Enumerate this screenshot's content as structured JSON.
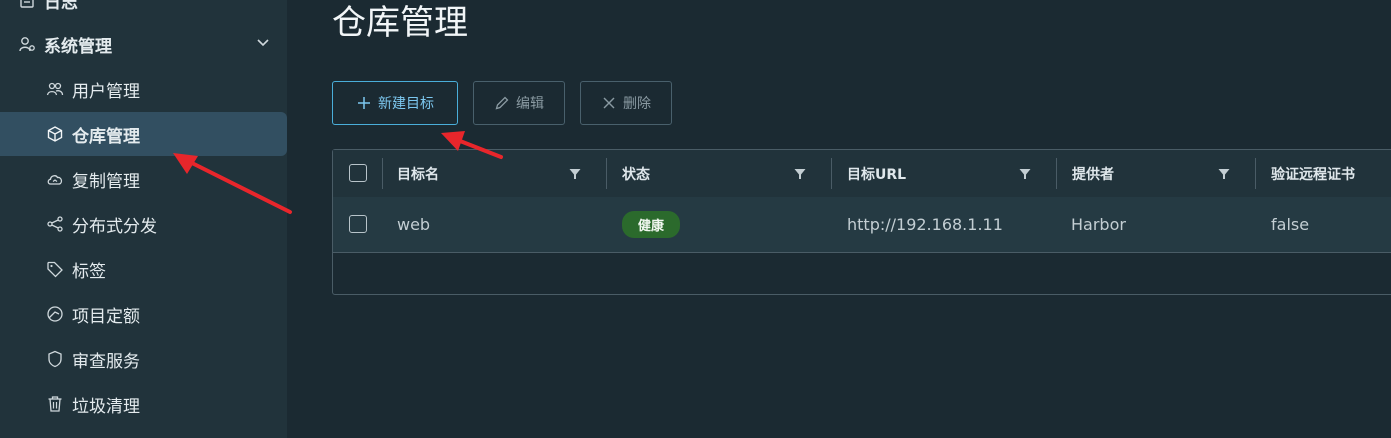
{
  "sidebar": {
    "items": [
      {
        "label": "日志",
        "icon": "log-icon"
      },
      {
        "label": "系统管理",
        "icon": "system-settings-icon"
      },
      {
        "label": "用户管理",
        "icon": "users-icon"
      },
      {
        "label": "仓库管理",
        "icon": "cube-icon"
      },
      {
        "label": "复制管理",
        "icon": "cloud-sync-icon"
      },
      {
        "label": "分布式分发",
        "icon": "share-icon"
      },
      {
        "label": "标签",
        "icon": "tag-icon"
      },
      {
        "label": "项目定额",
        "icon": "quota-icon"
      },
      {
        "label": "审查服务",
        "icon": "shield-icon"
      },
      {
        "label": "垃圾清理",
        "icon": "trash-icon"
      }
    ]
  },
  "main": {
    "title": "仓库管理",
    "toolbar": {
      "new_label": "新建目标",
      "edit_label": "编辑",
      "delete_label": "删除"
    },
    "table": {
      "columns": [
        "目标名",
        "状态",
        "目标URL",
        "提供者",
        "验证远程证书"
      ],
      "rows": [
        {
          "name": "web",
          "status": "健康",
          "url": "http://192.168.1.11",
          "provider": "Harbor",
          "verify": "false"
        }
      ]
    }
  },
  "colors": {
    "accent": "#4aaed9",
    "healthy": "#2b6a2c",
    "annotation_arrow": "#e8262b"
  }
}
